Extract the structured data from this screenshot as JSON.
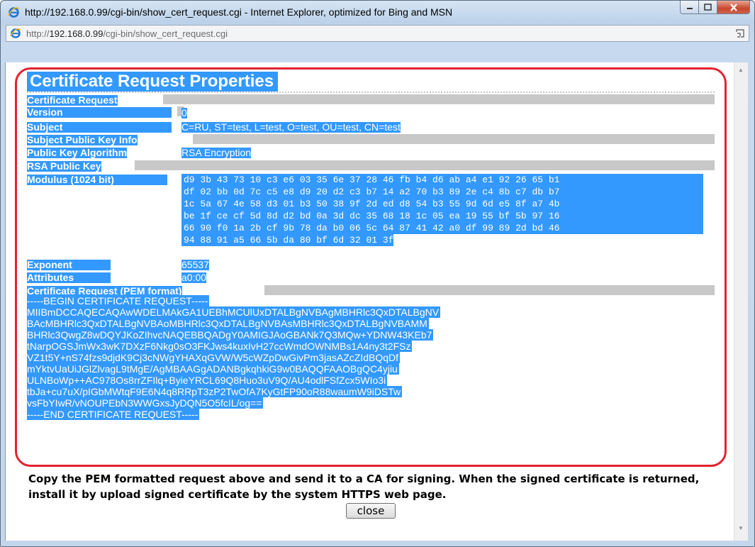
{
  "window": {
    "title": "http://192.168.0.99/cgi-bin/show_cert_request.cgi - Internet Explorer, optimized for Bing and MSN"
  },
  "address": {
    "prefix": "http://",
    "host": "192.168.0.99",
    "path": "/cgi-bin/show_cert_request.cgi"
  },
  "page": {
    "heading": "Certificate Request Properties",
    "fields": [
      {
        "label": "Certificate Request",
        "value": ""
      },
      {
        "label": "Version",
        "value": "0"
      },
      {
        "label": "Subject",
        "value": "C=RU, ST=test, L=test, O=test, OU=test, CN=test"
      },
      {
        "label": "Subject Public Key Info",
        "value": ""
      },
      {
        "label": "Public Key Algorithm",
        "value": "RSA Encryption"
      },
      {
        "label": "RSA Public Key",
        "value": ""
      },
      {
        "label": "Modulus (1024 bit)",
        "value": ""
      },
      {
        "label": "Exponent",
        "value": "65537"
      },
      {
        "label": "Attributes",
        "value": "a0:00"
      },
      {
        "label": "Certificate Request (PEM format)",
        "value": ""
      }
    ],
    "modulus": [
      "d9 3b 43 73 10 c3 e6 03 35 6e 37 28 46 fb b4 d6 ab a4 e1 92 26 65 b1",
      "df 02 bb 0d 7c c5 e8 d9 20 d2 c3 b7 14 a2 70 b3 89 2e c4 8b c7 db b7",
      "1c 5a 67 4e 58 d3 01 b3 50 38 9f 2d ed d8 54 b3 55 9d 6d e5 8f a7 4b",
      "be 1f ce cf 5d 8d d2 bd 0a 3d dc 35 68 18 1c 05 ea 19 55 bf 5b 97 16",
      "66 90 f0 1a 2b cf 9b 78 da b0 06 5c 64 87 41 42 a0 df 99 89 2d bd 46",
      "94 88 91 a5 66 5b da 80 bf 6d 32 01 3f"
    ],
    "pem": [
      "-----BEGIN CERTIFICATE REQUEST-----",
      "MIIBmDCCAQECAQAwWDELMAkGA1UEBhMCUlUxDTALBgNVBAgMBHRlc3QxDTALBgNV",
      "BAcMBHRlc3QxDTALBgNVBAoMBHRlc3QxDTALBgNVBAsMBHRlc3QxDTALBgNVBAMM",
      "BHRlc3QwgZ8wDQYJKoZIhvcNAQEBBQADgY0AMIGJAoGBANk7Q3MQw+YDNW43KEb7",
      "tNarpOGSJmWx3wK7DXzF6Nkg0sO3FKJws4kuxIvH27ccWmdOWNMBs1A4ny3t2FSz",
      "VZ1t5Y+nS74fzs9djdK9Cj3cNWgYHAXqGVW/W5cWZpDwGivPm3jasAZcZIdBQqDf",
      "mYktvUaUiJGlZlvagL9tMgE/AgMBAAGgADANBgkqhkiG9w0BAQQFAAOBgQC4yjiu",
      "ULNBoWp++AC978Os8rrZFIlq+ByieYRCL69Q8Huo3uV9Q/AU4odlFSfZcx5WIo3i",
      "tbJa+cu7uX/pIGbMWtqF9E6N4q8RRpT3zP2TwOfA7KyGtFP90oR88waumW9iDSTw",
      "vsFbYIwR/vNOUPEbN3WWGxsJyDQN5O5fcIL/og==",
      "-----END CERTIFICATE REQUEST-----"
    ],
    "note": "Copy the PEM formatted request above and send it to a CA for signing. When the signed certificate is returned, install it by upload signed certificate by the system HTTPS web page.",
    "close_label": "close"
  }
}
